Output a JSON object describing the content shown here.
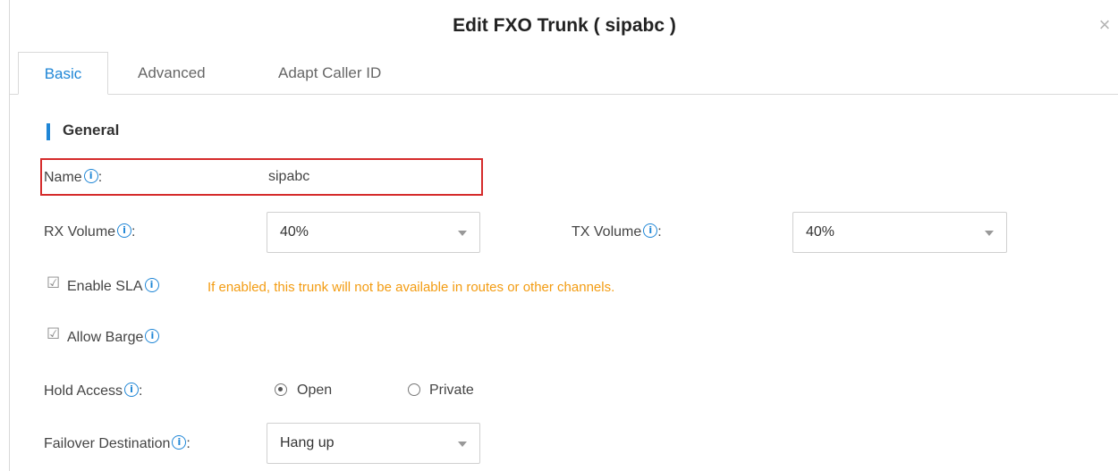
{
  "dialog": {
    "title": "Edit FXO Trunk ( sipabc )"
  },
  "tabs": [
    {
      "label": "Basic",
      "active": true
    },
    {
      "label": "Advanced",
      "active": false
    },
    {
      "label": "Adapt Caller ID",
      "active": false
    }
  ],
  "section": {
    "title": "General"
  },
  "fields": {
    "name": {
      "label": "Name",
      "suffix": ":",
      "value": "sipabc"
    },
    "rx_volume": {
      "label": "RX Volume",
      "suffix": ":",
      "value": "40%"
    },
    "tx_volume": {
      "label": "TX Volume",
      "suffix": ":",
      "value": "40%"
    },
    "enable_sla": {
      "label": "Enable SLA",
      "checked": true,
      "warning": "If enabled, this trunk will not be available in routes or other channels."
    },
    "allow_barge": {
      "label": "Allow Barge",
      "checked": true
    },
    "hold_access": {
      "label": "Hold Access",
      "suffix": ":",
      "options": [
        "Open",
        "Private"
      ],
      "selected": "Open"
    },
    "failover": {
      "label": "Failover Destination",
      "suffix": ":",
      "value": "Hang up"
    }
  },
  "colors": {
    "accent": "#1f86d6",
    "highlight": "#d52b2b",
    "warning": "#f39c12"
  }
}
